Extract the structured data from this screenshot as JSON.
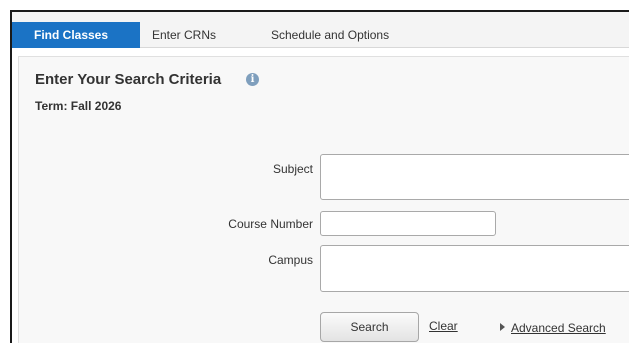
{
  "tabs": [
    {
      "label": "Find Classes",
      "active": true
    },
    {
      "label": "Enter CRNs",
      "active": false
    },
    {
      "label": "Schedule and Options",
      "active": false
    }
  ],
  "panel": {
    "heading": "Enter Your Search Criteria",
    "info_icon": "info-icon",
    "term": "Term: Fall 2026"
  },
  "form": {
    "subject_label": "Subject",
    "subject_value": "",
    "course_number_label": "Course Number",
    "course_number_value": "",
    "campus_label": "Campus",
    "campus_value": ""
  },
  "actions": {
    "search_label": "Search",
    "clear_label": "Clear",
    "advanced_label": "Advanced Search"
  },
  "colors": {
    "active_tab": "#1b73c5",
    "info_icon": "#7f9fbd"
  }
}
